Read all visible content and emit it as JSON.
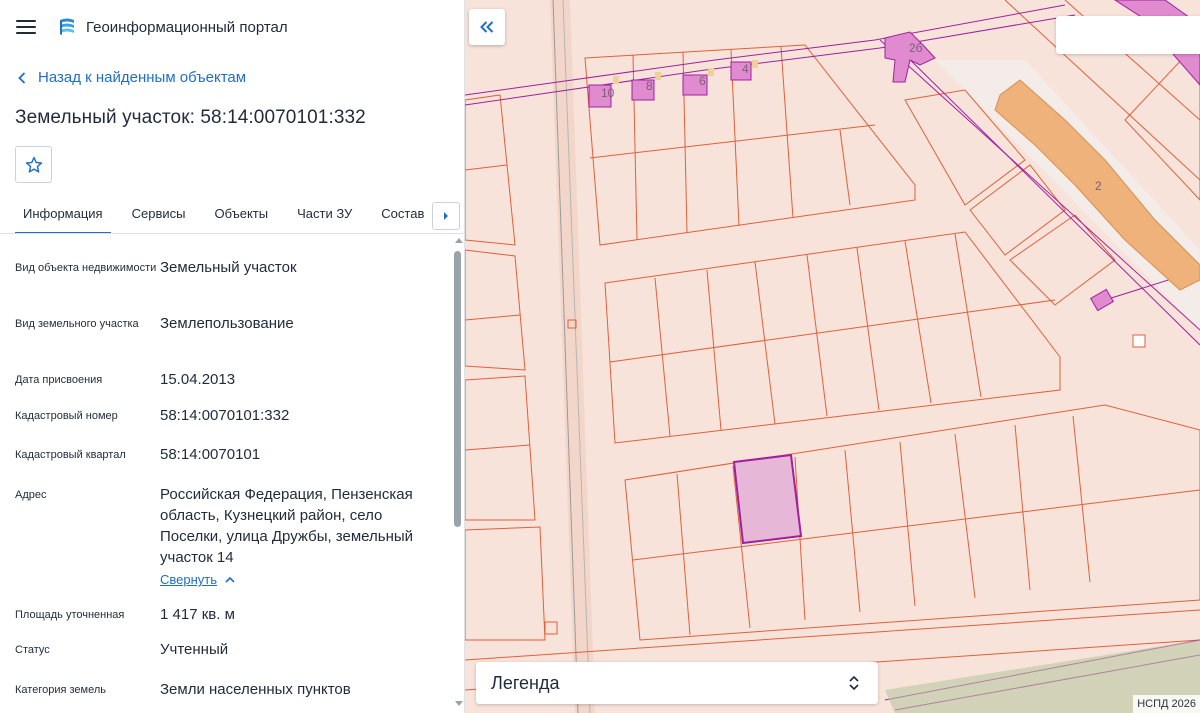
{
  "header": {
    "app_title": "Геоинформационный портал"
  },
  "back_link": "Назад к найденным объектам",
  "object_title": "Земельный участок: 58:14:0070101:332",
  "tabs": [
    "Информация",
    "Сервисы",
    "Объекты",
    "Части ЗУ",
    "Состав"
  ],
  "properties": [
    {
      "label": "Вид объекта недвижимости",
      "value": "Земельный участок"
    },
    {
      "label": "Вид земельного участка",
      "value": "Землепользование"
    },
    {
      "label": "Дата присвоения",
      "value": "15.04.2013"
    },
    {
      "label": "Кадастровый номер",
      "value": "58:14:0070101:332"
    },
    {
      "label": "Кадастровый квартал",
      "value": "58:14:0070101"
    },
    {
      "label": "Адрес",
      "value": "Российская Федерация, Пензенская область, Кузнецкий район, село Поселки, улица Дружбы, земельный участок 14"
    },
    {
      "label": "Площадь уточненная",
      "value": "1 417 кв. м"
    },
    {
      "label": "Статус",
      "value": "Учтенный"
    },
    {
      "label": "Категория земель",
      "value": "Земли населенных пунктов"
    }
  ],
  "collapse_link": "Свернуть",
  "map": {
    "building_labels": [
      "10",
      "8",
      "6",
      "4",
      "2б",
      "2"
    ],
    "legend_label": "Легенда",
    "attribution": "НСПД 2026"
  },
  "colors": {
    "accent": "#1f6fc5",
    "map_background": "#f7e3da",
    "parcel_border": "#e0603a",
    "selected_parcel": "#a020a0",
    "building_fill": "#e08ad0",
    "large_building": "#efb27a"
  },
  "icons": {
    "menu": "menu-icon",
    "logo": "portal-logo-icon",
    "back": "chevron-left-icon",
    "favorite": "star-icon",
    "tabs_next": "chevron-right-icon",
    "collapse_panel": "double-chevron-left-icon",
    "legend_toggle": "unfold-icon",
    "collapse_text": "chevron-up-icon"
  }
}
